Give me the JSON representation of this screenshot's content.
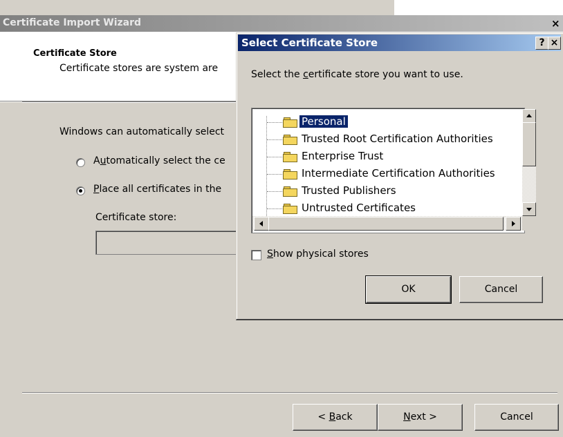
{
  "wizard": {
    "title": "Certificate Import Wizard",
    "close_glyph": "×",
    "heading": "Certificate Store",
    "subheading": "Certificate stores are system are",
    "intro": "Windows can automatically select",
    "radio_auto": {
      "prefix": "A",
      "accel": "u",
      "rest": "tomatically select the ce",
      "selected": false
    },
    "radio_place": {
      "accel": "P",
      "rest": "lace all certificates in the",
      "selected": true
    },
    "store_label": "Certificate store:",
    "store_value": "",
    "buttons": {
      "back": {
        "pre": "< ",
        "accel": "B",
        "rest": "ack"
      },
      "next": {
        "accel": "N",
        "rest": "ext >"
      },
      "cancel": "Cancel"
    }
  },
  "dialog": {
    "title": "Select Certificate Store",
    "help_glyph": "?",
    "close_glyph": "×",
    "instruction": {
      "pre": "Select the ",
      "accel": "c",
      "rest": "ertificate store you want to use."
    },
    "stores": [
      {
        "label": "Personal",
        "selected": true
      },
      {
        "label": "Trusted Root Certification Authorities",
        "selected": false
      },
      {
        "label": "Enterprise Trust",
        "selected": false
      },
      {
        "label": "Intermediate Certification Authorities",
        "selected": false
      },
      {
        "label": "Trusted Publishers",
        "selected": false
      },
      {
        "label": "Untrusted Certificates",
        "selected": false
      }
    ],
    "show_physical": {
      "accel": "S",
      "rest": "how physical stores",
      "checked": false
    },
    "ok_label": "OK",
    "cancel_label": "Cancel"
  },
  "icons": [
    "folder-icon",
    "radio-icon",
    "checkbox-icon",
    "help-icon",
    "close-icon",
    "scroll-up-icon",
    "scroll-down-icon",
    "scroll-left-icon",
    "scroll-right-icon"
  ],
  "colors": {
    "face": "#d4d0c8",
    "active_title": "#0a246a",
    "inactive_title": "#808080",
    "selection": "#0a246a"
  }
}
